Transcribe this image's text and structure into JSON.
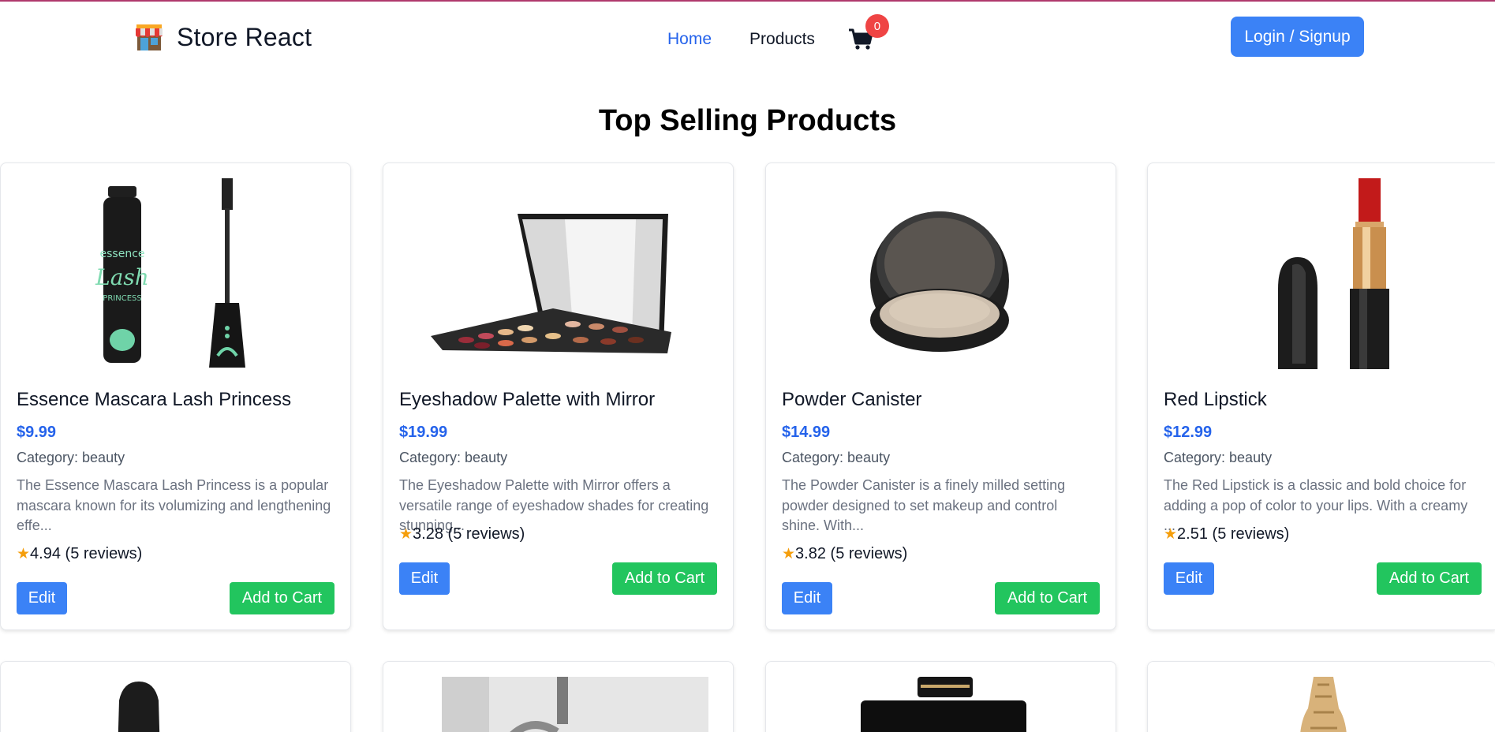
{
  "navbar": {
    "brand": "Store React",
    "links": {
      "home": "Home",
      "products": "Products"
    },
    "cart_count": "0",
    "login_label": "Login / Signup"
  },
  "section_title": "Top Selling Products",
  "products": [
    {
      "title": "Essence Mascara Lash Princess",
      "price": "$9.99",
      "category": "Category: beauty",
      "description": "The Essence Mascara Lash Princess is a popular mascara known for its volumizing and lengthening effe...",
      "rating": "4.94 (5 reviews)",
      "image_icon": "mascara-image",
      "edit_label": "Edit",
      "add_label": "Add to Cart"
    },
    {
      "title": "Eyeshadow Palette with Mirror",
      "price": "$19.99",
      "category": "Category: beauty",
      "description": "The Eyeshadow Palette with Mirror offers a versatile range of eyeshadow shades for creating stunning...",
      "rating": "3.28 (5 reviews)",
      "image_icon": "eyeshadow-palette-image",
      "edit_label": "Edit",
      "add_label": "Add to Cart"
    },
    {
      "title": "Powder Canister",
      "price": "$14.99",
      "category": "Category: beauty",
      "description": "The Powder Canister is a finely milled setting powder designed to set makeup and control shine. With...",
      "rating": "3.82 (5 reviews)",
      "image_icon": "powder-canister-image",
      "edit_label": "Edit",
      "add_label": "Add to Cart"
    },
    {
      "title": "Red Lipstick",
      "price": "$12.99",
      "category": "Category: beauty",
      "description": "The Red Lipstick is a classic and bold choice for adding a pop of color to your lips. With a creamy ...",
      "rating": "2.51 (5 reviews)",
      "image_icon": "lipstick-image",
      "edit_label": "Edit",
      "add_label": "Add to Cart"
    }
  ],
  "colors": {
    "accent": "#2563eb",
    "primary_button": "#3b82f6",
    "add_button": "#22c55e",
    "badge": "#ef4444",
    "star": "#f59e0b"
  }
}
